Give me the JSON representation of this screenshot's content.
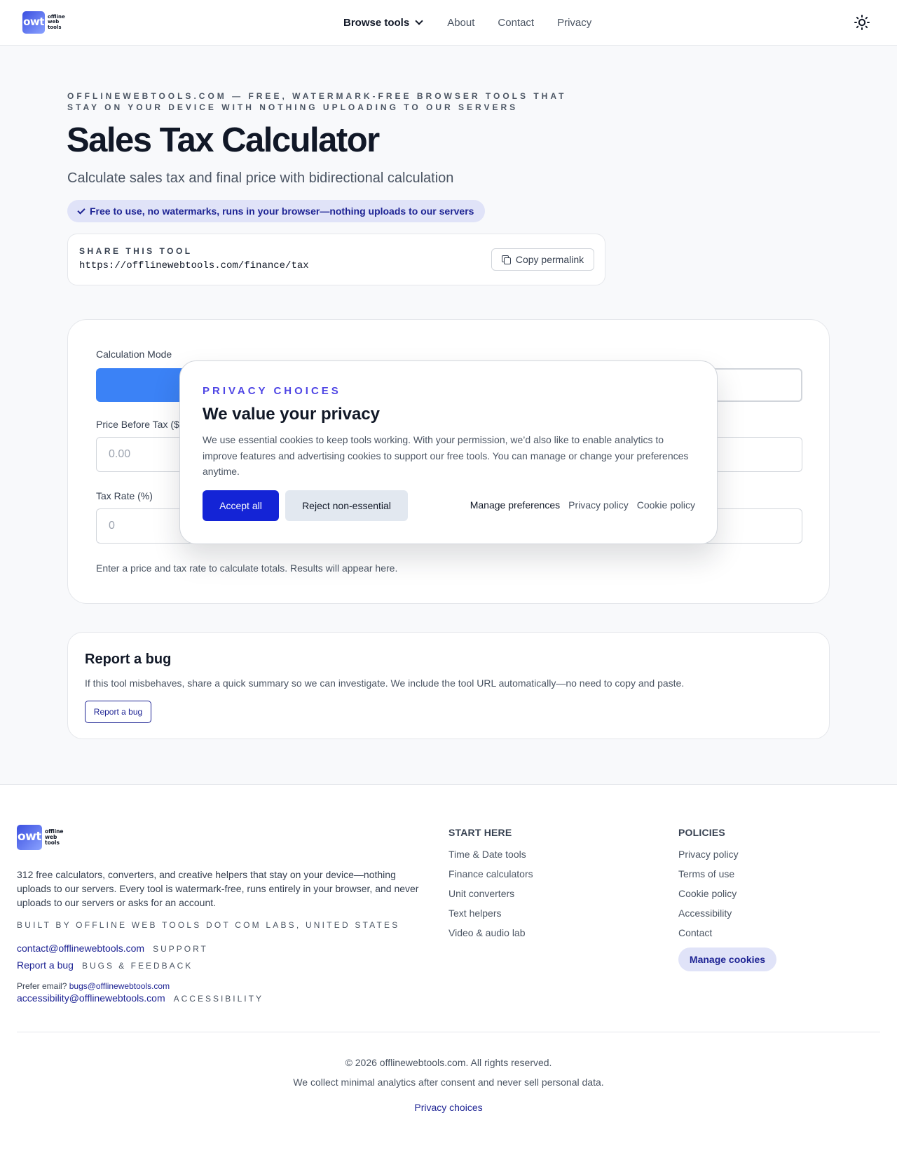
{
  "header": {
    "logo_mark": "owt",
    "logo_text": [
      "offline",
      "web",
      "tools"
    ],
    "nav": {
      "browse": "Browse tools",
      "about": "About",
      "contact": "Contact",
      "privacy": "Privacy"
    },
    "theme_icon": "sun-icon"
  },
  "hero": {
    "eyebrow": "OFFLINEWEBTOOLS.COM — FREE, WATERMARK-FREE BROWSER TOOLS THAT STAY ON YOUR DEVICE WITH NOTHING UPLOADING TO OUR SERVERS",
    "title": "Sales Tax Calculator",
    "subtitle": "Calculate sales tax and final price with bidirectional calculation",
    "pill": "Free to use, no watermarks, runs in your browser—nothing uploads to our servers"
  },
  "share": {
    "label": "SHARE THIS TOOL",
    "url": "https://offlinewebtools.com/finance/tax",
    "copy_label": "Copy permalink"
  },
  "calculator": {
    "mode_label": "Calculation Mode",
    "price_label": "Price Before Tax ($",
    "price_placeholder": "0.00",
    "rate_label": "Tax Rate (%)",
    "rate_placeholder": "0",
    "hint": "Enter a price and tax rate to calculate totals. Results will appear here."
  },
  "bug": {
    "title": "Report a bug",
    "description": "If this tool misbehaves, share a quick summary so we can investigate. We include the tool URL automatically—no need to copy and paste.",
    "button": "Report a bug"
  },
  "modal": {
    "eyebrow": "PRIVACY CHOICES",
    "title": "We value your privacy",
    "body": "We use essential cookies to keep tools working. With your permission, we’d also like to enable analytics to improve features and advertising cookies to support our free tools. You can manage or change your preferences anytime.",
    "accept": "Accept all",
    "reject": "Reject non-essential",
    "manage": "Manage preferences",
    "privacy_policy": "Privacy policy",
    "cookie_policy": "Cookie policy"
  },
  "footer": {
    "description": "312 free calculators, converters, and creative helpers that stay on your device—nothing uploads to our servers. Every tool is watermark-free, runs entirely in your browser, and never uploads to our servers or asks for an account.",
    "built_by": "BUILT BY OFFLINE WEB TOOLS DOT COM LABS, UNITED STATES",
    "support_email": "contact@offlinewebtools.com",
    "support_tag": "SUPPORT",
    "bug_link": "Report a bug",
    "bug_tag": "BUGS & FEEDBACK",
    "prefer_email": "Prefer email?",
    "bugs_email": "bugs@offlinewebtools.com",
    "accessibility_email": "accessibility@offlinewebtools.com",
    "accessibility_tag": "ACCESSIBILITY",
    "start_here": {
      "heading": "START HERE",
      "items": [
        "Time & Date tools",
        "Finance calculators",
        "Unit converters",
        "Text helpers",
        "Video & audio lab"
      ]
    },
    "policies": {
      "heading": "POLICIES",
      "items": [
        "Privacy policy",
        "Terms of use",
        "Cookie policy",
        "Accessibility",
        "Contact"
      ],
      "manage_cookies": "Manage cookies"
    },
    "copyright": "© 2026 offlinewebtools.com. All rights reserved.",
    "analytics_note": "We collect minimal analytics after consent and never sell personal data.",
    "privacy_choices": "Privacy choices"
  }
}
